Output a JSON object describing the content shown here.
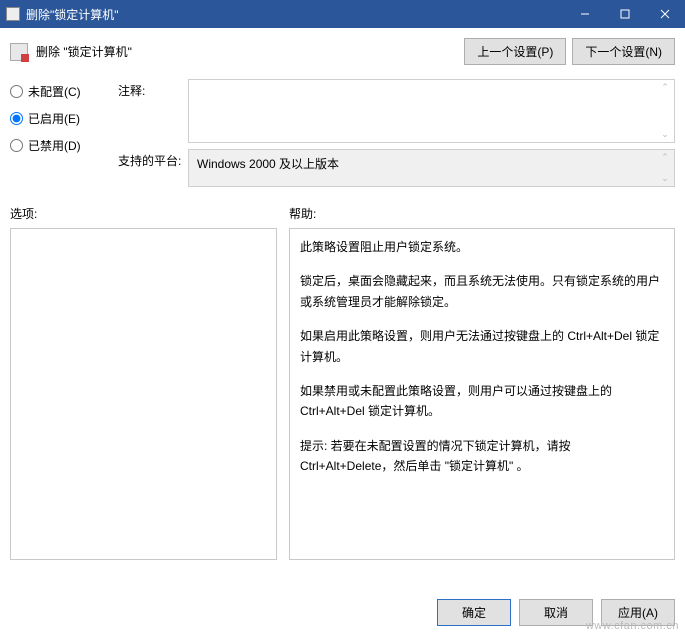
{
  "title": "删除\"锁定计算机\"",
  "header": {
    "policy_name": "删除 \"锁定计算机\"",
    "prev_setting": "上一个设置(P)",
    "next_setting": "下一个设置(N)"
  },
  "radios": {
    "not_configured": "未配置(C)",
    "enabled": "已启用(E)",
    "disabled": "已禁用(D)",
    "selected": "enabled"
  },
  "labels": {
    "comment": "注释:",
    "supported_on": "支持的平台:",
    "options": "选项:",
    "help": "帮助:"
  },
  "platform": "Windows 2000 及以上版本",
  "help_paragraphs": [
    "此策略设置阻止用户锁定系统。",
    "锁定后，桌面会隐藏起来，而且系统无法使用。只有锁定系统的用户或系统管理员才能解除锁定。",
    "如果启用此策略设置，则用户无法通过按键盘上的 Ctrl+Alt+Del 锁定计算机。",
    "如果禁用或未配置此策略设置，则用户可以通过按键盘上的 Ctrl+Alt+Del 锁定计算机。",
    "提示: 若要在未配置设置的情况下锁定计算机，请按 Ctrl+Alt+Delete，然后单击 \"锁定计算机\" 。"
  ],
  "footer": {
    "ok": "确定",
    "cancel": "取消",
    "apply": "应用(A)"
  },
  "watermark": "www.cfan.com.cn"
}
